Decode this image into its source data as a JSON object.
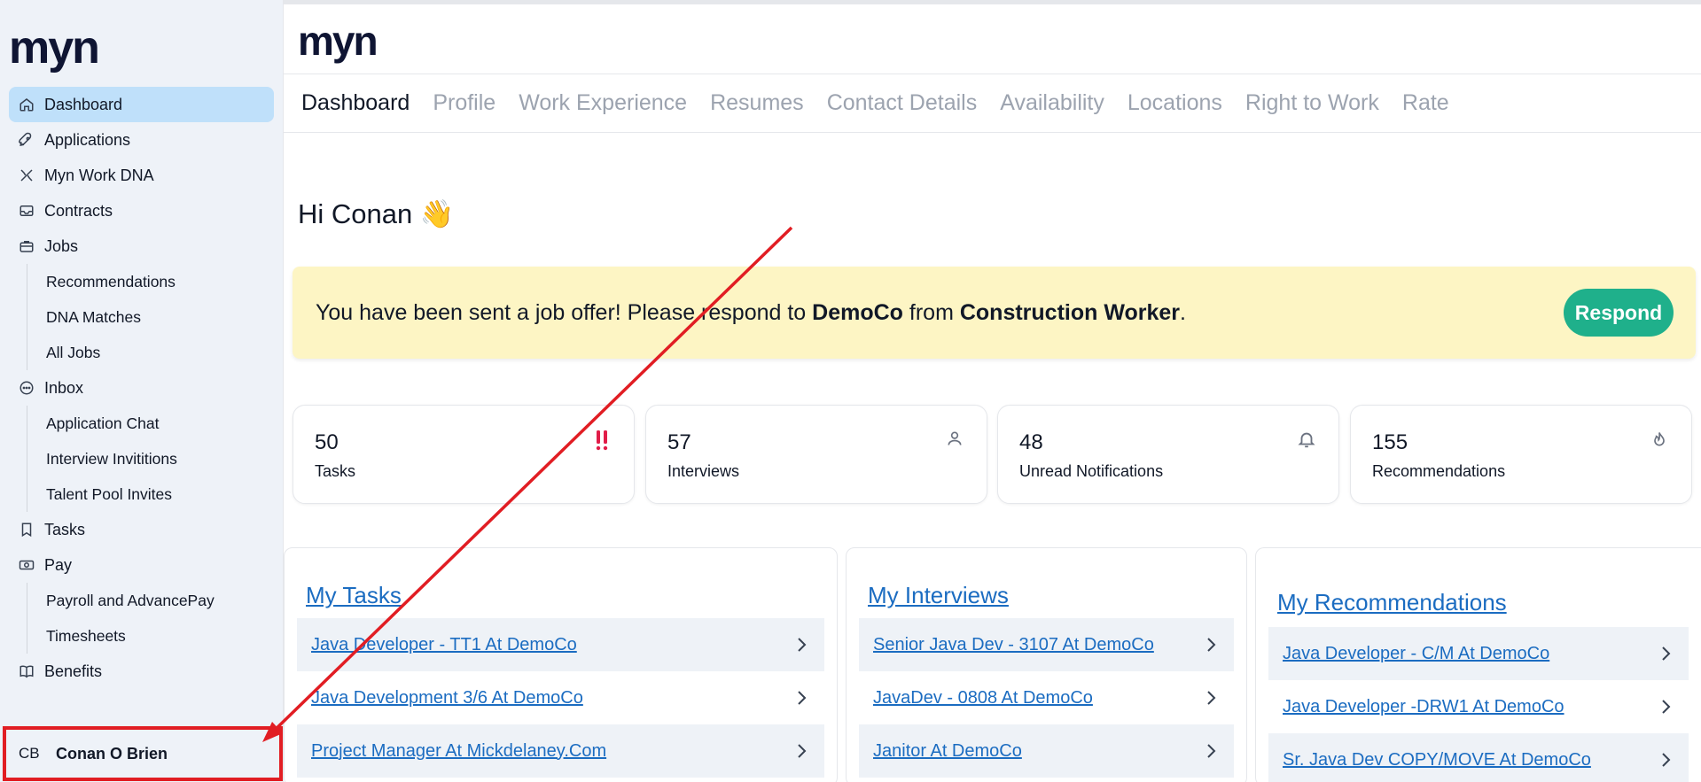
{
  "brand": {
    "logo": "myn"
  },
  "sidebar": {
    "items": [
      {
        "label": "Dashboard",
        "icon": "home-icon",
        "active": true
      },
      {
        "label": "Applications",
        "icon": "rocket-icon"
      },
      {
        "label": "Myn Work DNA",
        "icon": "dna-icon"
      },
      {
        "label": "Contracts",
        "icon": "inbox-tray-icon"
      },
      {
        "label": "Jobs",
        "icon": "briefcase-icon",
        "sub": [
          "Recommendations",
          "DNA Matches",
          "All Jobs"
        ]
      },
      {
        "label": "Inbox",
        "icon": "chat-bubble-icon",
        "sub": [
          "Application Chat",
          "Interview Invititions",
          "Talent Pool Invites"
        ]
      },
      {
        "label": "Tasks",
        "icon": "bookmark-icon"
      },
      {
        "label": "Pay",
        "icon": "money-icon",
        "sub": [
          "Payroll and AdvancePay",
          "Timesheets"
        ]
      },
      {
        "label": "Benefits",
        "icon": "book-icon"
      }
    ],
    "user": {
      "initials": "CB",
      "name": "Conan O Brien"
    }
  },
  "tabs": [
    "Dashboard",
    "Profile",
    "Work Experience",
    "Resumes",
    "Contact Details",
    "Availability",
    "Locations",
    "Right to Work",
    "Rate"
  ],
  "greeting": {
    "text": "Hi Conan",
    "emoji": "👋"
  },
  "alert": {
    "prefix": "You have been sent a job offer! Please respond to ",
    "company": "DemoCo",
    "middle": " from ",
    "role": "Construction Worker",
    "suffix": ".",
    "button": "Respond"
  },
  "stats": [
    {
      "value": "50",
      "label": "Tasks",
      "icon": "double-exclamation-icon",
      "color": "#e11d48"
    },
    {
      "value": "57",
      "label": "Interviews",
      "icon": "user-icon"
    },
    {
      "value": "48",
      "label": "Unread Notifications",
      "icon": "bell-icon"
    },
    {
      "value": "155",
      "label": "Recommendations",
      "icon": "flame-icon"
    }
  ],
  "panels": {
    "tasks": {
      "title": "My Tasks",
      "items": [
        "Java Developer - TT1 At DemoCo",
        "Java Development 3/6 At DemoCo",
        "Project Manager At Mickdelaney.Com"
      ]
    },
    "interviews": {
      "title": "My Interviews",
      "items": [
        "Senior Java Dev - 3107 At DemoCo",
        "JavaDev - 0808 At DemoCo",
        "Janitor At DemoCo"
      ]
    },
    "recommendations": {
      "title": "My Recommendations",
      "items": [
        "Java Developer - C/M At DemoCo",
        "Java Developer -DRW1 At DemoCo",
        "Sr. Java Dev COPY/MOVE At DemoCo"
      ]
    }
  },
  "colors": {
    "accent": "#1fb08b",
    "link": "#1b6cc1",
    "annotation": "#e11d23",
    "active_nav": "#bfe0fa",
    "alert_bg": "#fdf5c4"
  }
}
